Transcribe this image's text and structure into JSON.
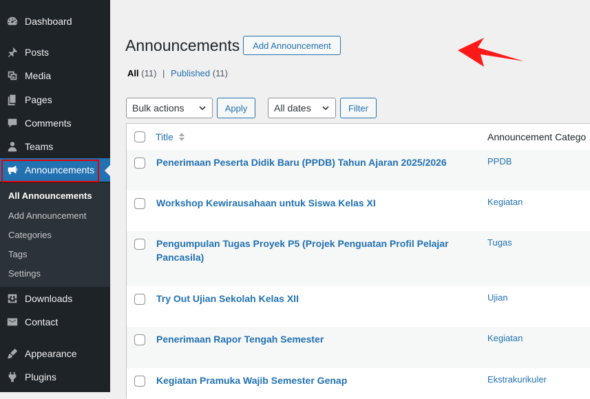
{
  "sidebar": {
    "items": [
      {
        "label": "Dashboard",
        "icon": "dashboard-icon"
      },
      {
        "label": "Posts",
        "icon": "pin-icon"
      },
      {
        "label": "Media",
        "icon": "media-icon"
      },
      {
        "label": "Pages",
        "icon": "pages-icon"
      },
      {
        "label": "Comments",
        "icon": "comment-icon"
      },
      {
        "label": "Teams",
        "icon": "users-icon"
      },
      {
        "label": "Announcements",
        "icon": "megaphone-icon"
      },
      {
        "label": "Downloads",
        "icon": "download-icon"
      },
      {
        "label": "Contact",
        "icon": "mail-icon"
      },
      {
        "label": "Appearance",
        "icon": "brush-icon"
      },
      {
        "label": "Plugins",
        "icon": "plug-icon"
      }
    ],
    "submenu": [
      {
        "label": "All Announcements"
      },
      {
        "label": "Add Announcement"
      },
      {
        "label": "Categories"
      },
      {
        "label": "Tags"
      },
      {
        "label": "Settings"
      }
    ]
  },
  "header": {
    "title": "Announcements",
    "add_button": "Add Announcement"
  },
  "views": {
    "all_label": "All",
    "all_count": "(11)",
    "separator": "|",
    "published_label": "Published",
    "published_count": "(11)"
  },
  "filters": {
    "bulk_actions": "Bulk actions",
    "apply": "Apply",
    "dates": "All dates",
    "filter": "Filter"
  },
  "table": {
    "columns": [
      "Title",
      "Announcement Catego"
    ],
    "rows": [
      {
        "title": "Penerimaan Peserta Didik Baru (PPDB) Tahun Ajaran 2025/2026",
        "category": "PPDB"
      },
      {
        "title": "Workshop Kewirausahaan untuk Siswa Kelas XI",
        "category": "Kegiatan"
      },
      {
        "title": "Pengumpulan Tugas Proyek P5 (Projek Penguatan Profil Pelajar Pancasila)",
        "category": "Tugas"
      },
      {
        "title": "Try Out Ujian Sekolah Kelas XII",
        "category": "Ujian"
      },
      {
        "title": "Penerimaan Rapor Tengah Semester",
        "category": "Kegiatan"
      },
      {
        "title": "Kegiatan Pramuka Wajib Semester Genap",
        "category": "Ekstrakurikuler"
      }
    ]
  },
  "colors": {
    "sidebar_bg": "#1d2327",
    "accent": "#2271b1",
    "highlight_outline": "#e40000",
    "annotation_arrow": "#ff1a1a"
  }
}
